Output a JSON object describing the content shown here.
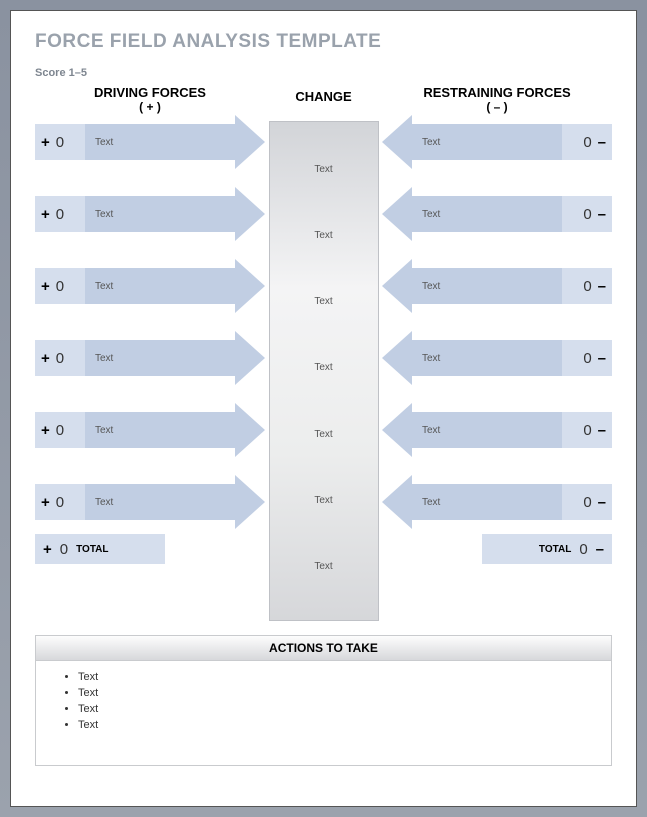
{
  "title": "FORCE FIELD ANALYSIS TEMPLATE",
  "score_label": "Score 1–5",
  "headers": {
    "driving": "DRIVING FORCES",
    "driving_sign": "( + )",
    "change": "CHANGE",
    "restraining": "RESTRAINING FORCES",
    "restraining_sign": "( – )"
  },
  "driving": [
    {
      "score": "0",
      "label": "Text"
    },
    {
      "score": "0",
      "label": "Text"
    },
    {
      "score": "0",
      "label": "Text"
    },
    {
      "score": "0",
      "label": "Text"
    },
    {
      "score": "0",
      "label": "Text"
    },
    {
      "score": "0",
      "label": "Text"
    }
  ],
  "restraining": [
    {
      "score": "0",
      "label": "Text"
    },
    {
      "score": "0",
      "label": "Text"
    },
    {
      "score": "0",
      "label": "Text"
    },
    {
      "score": "0",
      "label": "Text"
    },
    {
      "score": "0",
      "label": "Text"
    },
    {
      "score": "0",
      "label": "Text"
    }
  ],
  "change_items": [
    "Text",
    "Text",
    "Text",
    "Text",
    "Text",
    "Text",
    "Text"
  ],
  "totals": {
    "label": "TOTAL",
    "driving": "0",
    "restraining": "0"
  },
  "actions": {
    "header": "ACTIONS TO TAKE",
    "items": [
      "Text",
      "Text",
      "Text",
      "Text"
    ]
  },
  "signs": {
    "plus": "+",
    "minus": "–"
  }
}
